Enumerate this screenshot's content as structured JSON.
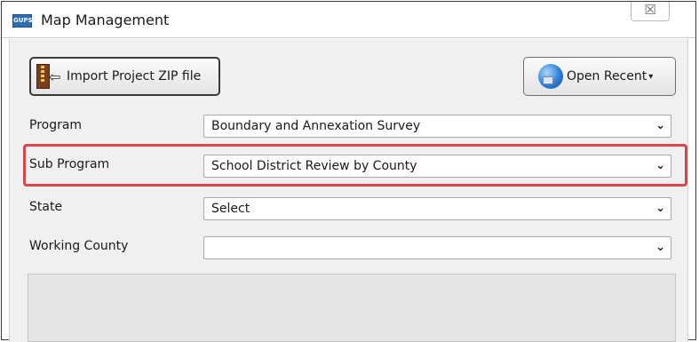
{
  "window": {
    "title": "Map Management",
    "app_icon_text": "GUPS",
    "close_glyph": "☒"
  },
  "toolbar": {
    "import_label": "Import Project ZIP file",
    "open_recent_label": "Open Recent",
    "open_recent_caret": "▾"
  },
  "form": {
    "program": {
      "label": "Program",
      "value": "Boundary and Annexation Survey"
    },
    "sub_program": {
      "label": "Sub Program",
      "value": "School District Review by County"
    },
    "state": {
      "label": "State",
      "value": "Select"
    },
    "working_county": {
      "label": "Working County",
      "value": ""
    }
  },
  "dropdown_glyph": "⌄",
  "colors": {
    "highlight": "#d9454b",
    "dialog_bg": "#f0f0f0",
    "app_icon": "#2e6db4"
  },
  "icons": {
    "app": "app-logo-icon",
    "import": "zip-archive-icon",
    "recent": "globe-icon",
    "close": "close-icon",
    "dropdown": "chevron-down-icon"
  }
}
